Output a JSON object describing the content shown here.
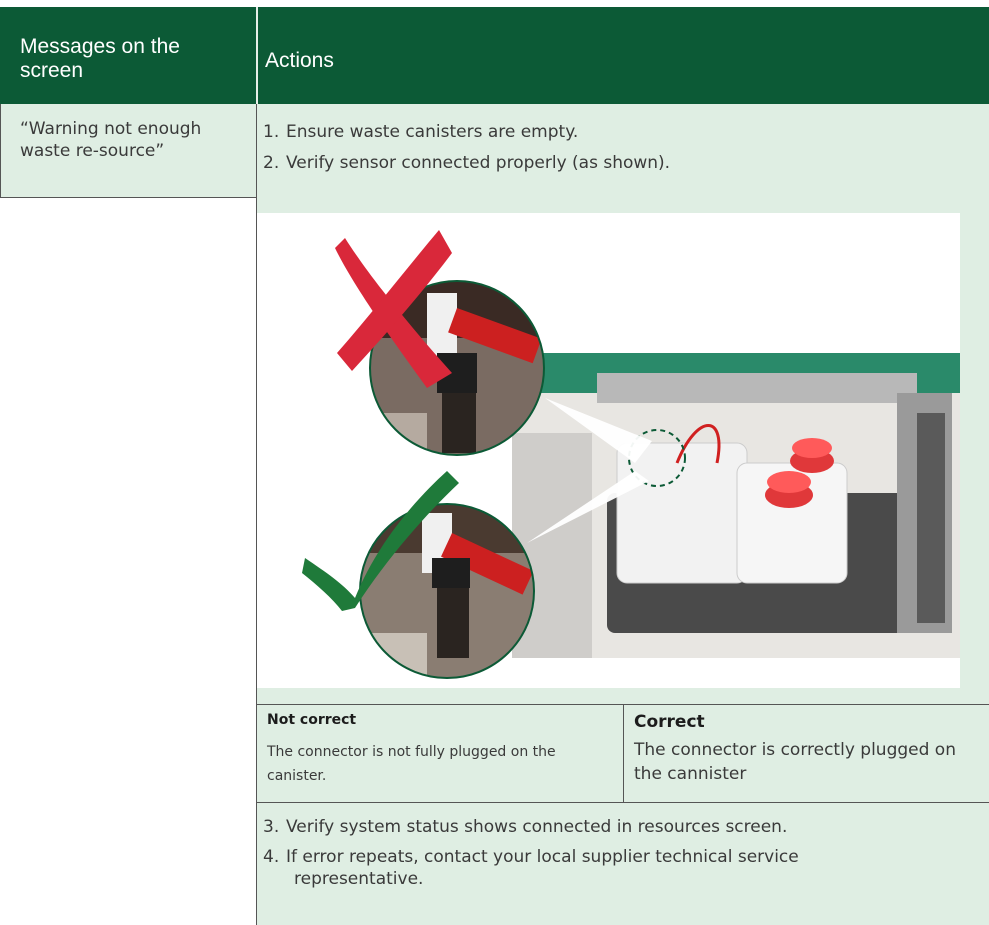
{
  "header": {
    "col1": "Messages on the screen",
    "col2": "Actions"
  },
  "message": "“Warning not enough waste re-source”",
  "steps": [
    {
      "num": "1.",
      "text": "Ensure waste canisters are empty."
    },
    {
      "num": "2.",
      "text": "Verify sensor connected properly (as shown)."
    },
    {
      "num": "3.",
      "text": "Verify system status shows connected in resources screen."
    },
    {
      "num": "4.",
      "text": "If error repeats, contact your local supplier technical service",
      "text2": "representative."
    }
  ],
  "comparison": {
    "incorrect": {
      "title": "Not correct",
      "text": "The connector is not fully plugged on the canister."
    },
    "correct": {
      "title": "Correct",
      "text": "The connector is correctly plugged on the cannister"
    }
  },
  "colors": {
    "header_bg": "#0c5a36",
    "body_bg": "#dfeee3",
    "cross": "#d9283a",
    "check": "#1f7a3a",
    "cap_red": "#e0383a"
  }
}
